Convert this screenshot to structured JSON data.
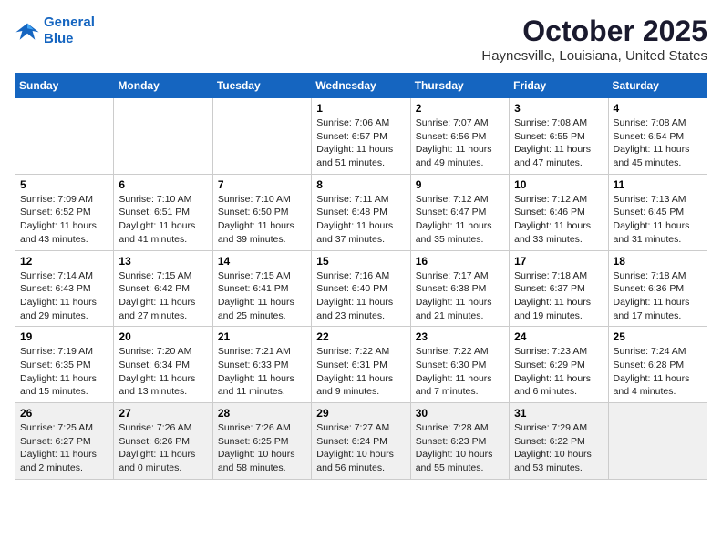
{
  "logo": {
    "line1": "General",
    "line2": "Blue"
  },
  "title": "October 2025",
  "location": "Haynesville, Louisiana, United States",
  "weekdays": [
    "Sunday",
    "Monday",
    "Tuesday",
    "Wednesday",
    "Thursday",
    "Friday",
    "Saturday"
  ],
  "weeks": [
    [
      {
        "day": "",
        "content": ""
      },
      {
        "day": "",
        "content": ""
      },
      {
        "day": "",
        "content": ""
      },
      {
        "day": "1",
        "content": "Sunrise: 7:06 AM\nSunset: 6:57 PM\nDaylight: 11 hours\nand 51 minutes."
      },
      {
        "day": "2",
        "content": "Sunrise: 7:07 AM\nSunset: 6:56 PM\nDaylight: 11 hours\nand 49 minutes."
      },
      {
        "day": "3",
        "content": "Sunrise: 7:08 AM\nSunset: 6:55 PM\nDaylight: 11 hours\nand 47 minutes."
      },
      {
        "day": "4",
        "content": "Sunrise: 7:08 AM\nSunset: 6:54 PM\nDaylight: 11 hours\nand 45 minutes."
      }
    ],
    [
      {
        "day": "5",
        "content": "Sunrise: 7:09 AM\nSunset: 6:52 PM\nDaylight: 11 hours\nand 43 minutes."
      },
      {
        "day": "6",
        "content": "Sunrise: 7:10 AM\nSunset: 6:51 PM\nDaylight: 11 hours\nand 41 minutes."
      },
      {
        "day": "7",
        "content": "Sunrise: 7:10 AM\nSunset: 6:50 PM\nDaylight: 11 hours\nand 39 minutes."
      },
      {
        "day": "8",
        "content": "Sunrise: 7:11 AM\nSunset: 6:48 PM\nDaylight: 11 hours\nand 37 minutes."
      },
      {
        "day": "9",
        "content": "Sunrise: 7:12 AM\nSunset: 6:47 PM\nDaylight: 11 hours\nand 35 minutes."
      },
      {
        "day": "10",
        "content": "Sunrise: 7:12 AM\nSunset: 6:46 PM\nDaylight: 11 hours\nand 33 minutes."
      },
      {
        "day": "11",
        "content": "Sunrise: 7:13 AM\nSunset: 6:45 PM\nDaylight: 11 hours\nand 31 minutes."
      }
    ],
    [
      {
        "day": "12",
        "content": "Sunrise: 7:14 AM\nSunset: 6:43 PM\nDaylight: 11 hours\nand 29 minutes."
      },
      {
        "day": "13",
        "content": "Sunrise: 7:15 AM\nSunset: 6:42 PM\nDaylight: 11 hours\nand 27 minutes."
      },
      {
        "day": "14",
        "content": "Sunrise: 7:15 AM\nSunset: 6:41 PM\nDaylight: 11 hours\nand 25 minutes."
      },
      {
        "day": "15",
        "content": "Sunrise: 7:16 AM\nSunset: 6:40 PM\nDaylight: 11 hours\nand 23 minutes."
      },
      {
        "day": "16",
        "content": "Sunrise: 7:17 AM\nSunset: 6:38 PM\nDaylight: 11 hours\nand 21 minutes."
      },
      {
        "day": "17",
        "content": "Sunrise: 7:18 AM\nSunset: 6:37 PM\nDaylight: 11 hours\nand 19 minutes."
      },
      {
        "day": "18",
        "content": "Sunrise: 7:18 AM\nSunset: 6:36 PM\nDaylight: 11 hours\nand 17 minutes."
      }
    ],
    [
      {
        "day": "19",
        "content": "Sunrise: 7:19 AM\nSunset: 6:35 PM\nDaylight: 11 hours\nand 15 minutes."
      },
      {
        "day": "20",
        "content": "Sunrise: 7:20 AM\nSunset: 6:34 PM\nDaylight: 11 hours\nand 13 minutes."
      },
      {
        "day": "21",
        "content": "Sunrise: 7:21 AM\nSunset: 6:33 PM\nDaylight: 11 hours\nand 11 minutes."
      },
      {
        "day": "22",
        "content": "Sunrise: 7:22 AM\nSunset: 6:31 PM\nDaylight: 11 hours\nand 9 minutes."
      },
      {
        "day": "23",
        "content": "Sunrise: 7:22 AM\nSunset: 6:30 PM\nDaylight: 11 hours\nand 7 minutes."
      },
      {
        "day": "24",
        "content": "Sunrise: 7:23 AM\nSunset: 6:29 PM\nDaylight: 11 hours\nand 6 minutes."
      },
      {
        "day": "25",
        "content": "Sunrise: 7:24 AM\nSunset: 6:28 PM\nDaylight: 11 hours\nand 4 minutes."
      }
    ],
    [
      {
        "day": "26",
        "content": "Sunrise: 7:25 AM\nSunset: 6:27 PM\nDaylight: 11 hours\nand 2 minutes."
      },
      {
        "day": "27",
        "content": "Sunrise: 7:26 AM\nSunset: 6:26 PM\nDaylight: 11 hours\nand 0 minutes."
      },
      {
        "day": "28",
        "content": "Sunrise: 7:26 AM\nSunset: 6:25 PM\nDaylight: 10 hours\nand 58 minutes."
      },
      {
        "day": "29",
        "content": "Sunrise: 7:27 AM\nSunset: 6:24 PM\nDaylight: 10 hours\nand 56 minutes."
      },
      {
        "day": "30",
        "content": "Sunrise: 7:28 AM\nSunset: 6:23 PM\nDaylight: 10 hours\nand 55 minutes."
      },
      {
        "day": "31",
        "content": "Sunrise: 7:29 AM\nSunset: 6:22 PM\nDaylight: 10 hours\nand 53 minutes."
      },
      {
        "day": "",
        "content": ""
      }
    ]
  ]
}
